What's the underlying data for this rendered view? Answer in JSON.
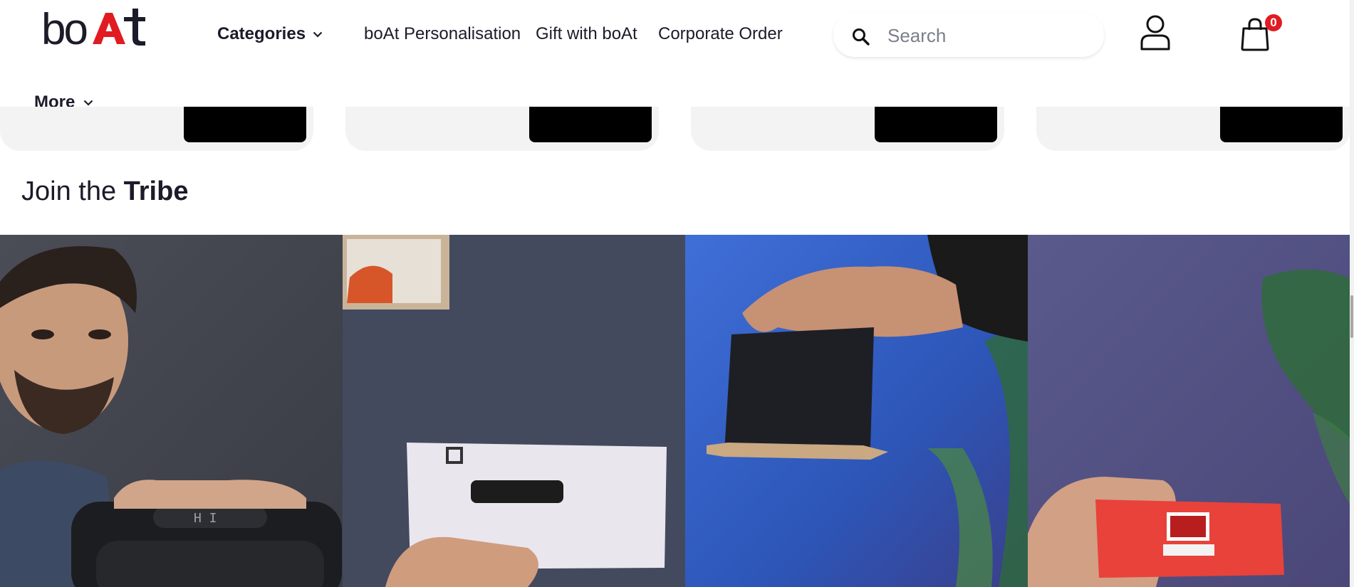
{
  "brand": {
    "logo_text": "boAt"
  },
  "nav": {
    "categories_label": "Categories",
    "links": [
      "boAt Personalisation",
      "Gift with boAt",
      "Corporate Order"
    ],
    "more_label": "More"
  },
  "search": {
    "placeholder": "Search"
  },
  "cart": {
    "count": "0"
  },
  "section": {
    "title_light": "Join the ",
    "title_bold": "Tribe"
  },
  "icons": [
    "logo",
    "chevron-down-icon",
    "search-icon",
    "user-icon",
    "cart-icon"
  ],
  "colors": {
    "brand_red": "#e11b22",
    "text": "#1b1b2a",
    "card_bg": "#f3f3f3"
  }
}
